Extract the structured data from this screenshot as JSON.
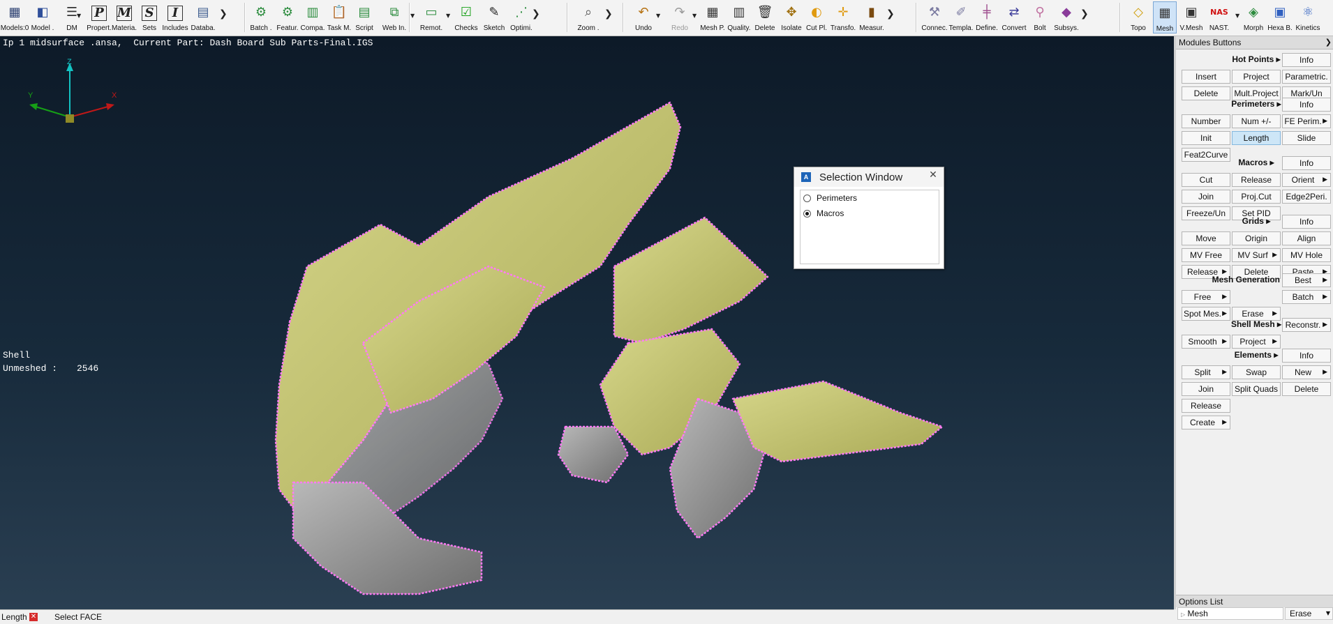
{
  "toolbar": {
    "buttons": [
      {
        "label": "Models:0",
        "icon": "models-icon"
      },
      {
        "label": "Model .",
        "icon": "model-icon"
      },
      {
        "label": "DM",
        "icon": "dm-icon"
      },
      {
        "label": "Propert.",
        "icon": "properties-icon",
        "glyph": "P"
      },
      {
        "label": "Materia.",
        "icon": "materials-icon",
        "glyph": "M"
      },
      {
        "label": "Sets",
        "icon": "sets-icon",
        "glyph": "S"
      },
      {
        "label": "Includes",
        "icon": "includes-icon",
        "glyph": "I"
      },
      {
        "label": "Databa.",
        "icon": "database-icon"
      },
      {
        "label": "Batch .",
        "icon": "batch-icon"
      },
      {
        "label": "Featur.",
        "icon": "features-icon"
      },
      {
        "label": "Compa.",
        "icon": "compare-icon"
      },
      {
        "label": "Task M.",
        "icon": "task-manager-icon"
      },
      {
        "label": "Script",
        "icon": "script-icon"
      },
      {
        "label": "Web In.",
        "icon": "web-icon"
      },
      {
        "label": "Remot.",
        "icon": "remote-icon"
      },
      {
        "label": "Checks",
        "icon": "checks-icon"
      },
      {
        "label": "Sketch",
        "icon": "sketch-icon"
      },
      {
        "label": "Optimi.",
        "icon": "optimization-icon"
      },
      {
        "label": "Zoom .",
        "icon": "zoom-icon"
      },
      {
        "label": "Undo",
        "icon": "undo-icon"
      },
      {
        "label": "Redo",
        "icon": "redo-icon"
      },
      {
        "label": "Mesh P.",
        "icon": "mesh-parameters-icon"
      },
      {
        "label": "Quality.",
        "icon": "quality-icon"
      },
      {
        "label": "Delete",
        "icon": "delete-icon"
      },
      {
        "label": "Isolate",
        "icon": "isolate-icon"
      },
      {
        "label": "Cut Pl.",
        "icon": "cut-plane-icon"
      },
      {
        "label": "Transfo.",
        "icon": "transform-icon"
      },
      {
        "label": "Measur.",
        "icon": "measure-icon"
      },
      {
        "label": "Connec.",
        "icon": "connections-icon"
      },
      {
        "label": "Templa.",
        "icon": "templates-icon"
      },
      {
        "label": "Define.",
        "icon": "define-icon"
      },
      {
        "label": "Convert",
        "icon": "convert-icon"
      },
      {
        "label": "Bolt",
        "icon": "bolt-icon"
      },
      {
        "label": "Subsys.",
        "icon": "subsystems-icon"
      },
      {
        "label": "Topo",
        "icon": "topo-icon"
      },
      {
        "label": "Mesh",
        "icon": "mesh-icon"
      },
      {
        "label": "V.Mesh",
        "icon": "volume-mesh-icon"
      },
      {
        "label": "NAST.",
        "icon": "nastran-icon",
        "glyph": "NAS"
      },
      {
        "label": "Morph",
        "icon": "morph-icon"
      },
      {
        "label": "Hexa B.",
        "icon": "hexa-block-icon"
      },
      {
        "label": "Kinetics",
        "icon": "kinetics-icon"
      }
    ]
  },
  "viewport": {
    "info_line": "Ip 1 midsurface .ansa,  Current Part: Dash Board Sub Parts-Final.IGS",
    "axes": {
      "z": "Z",
      "y": "Y",
      "x": "X"
    },
    "shell_label": "Shell",
    "unmeshed_label": "Unmeshed :",
    "unmeshed_count": "2546"
  },
  "selection_window": {
    "title": "Selection Window",
    "options": [
      {
        "label": "Perimeters",
        "selected": false
      },
      {
        "label": "Macros",
        "selected": true
      }
    ]
  },
  "panel": {
    "title": "Modules Buttons",
    "sections": [
      {
        "title": "Hot Points ▸",
        "buttons": [
          "Info",
          "Insert",
          "Project",
          "Parametric.",
          "Delete",
          "Mult.Project",
          "Mark/Un"
        ]
      },
      {
        "title": "Perimeters ▸",
        "buttons": [
          "Info",
          "Number",
          "Num +/-",
          "FE Perim.",
          "Init",
          "Length",
          "Slide",
          "Feat2Curve"
        ]
      },
      {
        "title": "Macros ▸",
        "buttons": [
          "Info",
          "Cut",
          "Release",
          "Orient",
          "Join",
          "Proj.Cut",
          "Edge2Peri.",
          "Freeze/Un",
          "Set PID"
        ]
      },
      {
        "title": "Grids ▸",
        "buttons": [
          "Info",
          "Move",
          "Origin",
          "Align",
          "MV Free",
          "MV Surf",
          "MV Hole",
          "Release",
          "Delete",
          "Paste"
        ]
      },
      {
        "title": "Mesh Generation ▸",
        "buttons": [
          "Best",
          "Free",
          "Batch",
          "Spot Mes.",
          "Erase"
        ]
      },
      {
        "title": "Shell Mesh ▸",
        "buttons": [
          "Reconstr.",
          "Smooth",
          "Project"
        ]
      },
      {
        "title": "Elements ▸",
        "buttons": [
          "Info",
          "Split",
          "Swap",
          "New",
          "Join",
          "Split Quads",
          "Delete",
          "Release",
          "Create"
        ]
      }
    ],
    "options_title": "Options List",
    "options_item": "Mesh",
    "options_value": "Erase"
  },
  "status": {
    "mode": "Length",
    "message": "Select FACE"
  }
}
